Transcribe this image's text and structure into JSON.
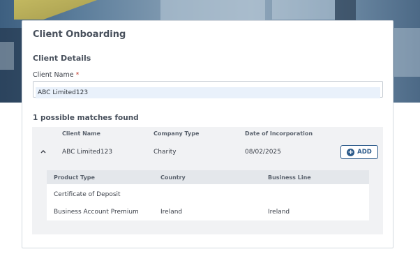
{
  "card": {
    "title": "Client Onboarding",
    "section_title": "Client Details",
    "field_label": "Client Name",
    "required_mark": "*",
    "client_name_value": "ABC Limited123"
  },
  "matches": {
    "title": "1 possible matches found",
    "columns": [
      "Client Name",
      "Company Type",
      "Date of Incorporation"
    ],
    "row": {
      "client_name": "ABC Limited123",
      "company_type": "Charity",
      "date_of_incorporation": "08/02/2025",
      "expand_icon": "chevron-up-icon",
      "add_label": "ADD",
      "add_icon": "plus-circle-icon"
    },
    "sub_columns": [
      "Product Type",
      "Country",
      "Business Line"
    ],
    "sub_rows": [
      {
        "product_type": "Certificate of Deposit",
        "country": "",
        "business_line": ""
      },
      {
        "product_type": "Business Account Premium",
        "country": "Ireland",
        "business_line": "Ireland"
      }
    ]
  },
  "colors": {
    "accent": "#2b5a8a",
    "required": "#c0392b",
    "results_bg": "#f1f2f4",
    "input_fill": "#e9f1fb"
  }
}
